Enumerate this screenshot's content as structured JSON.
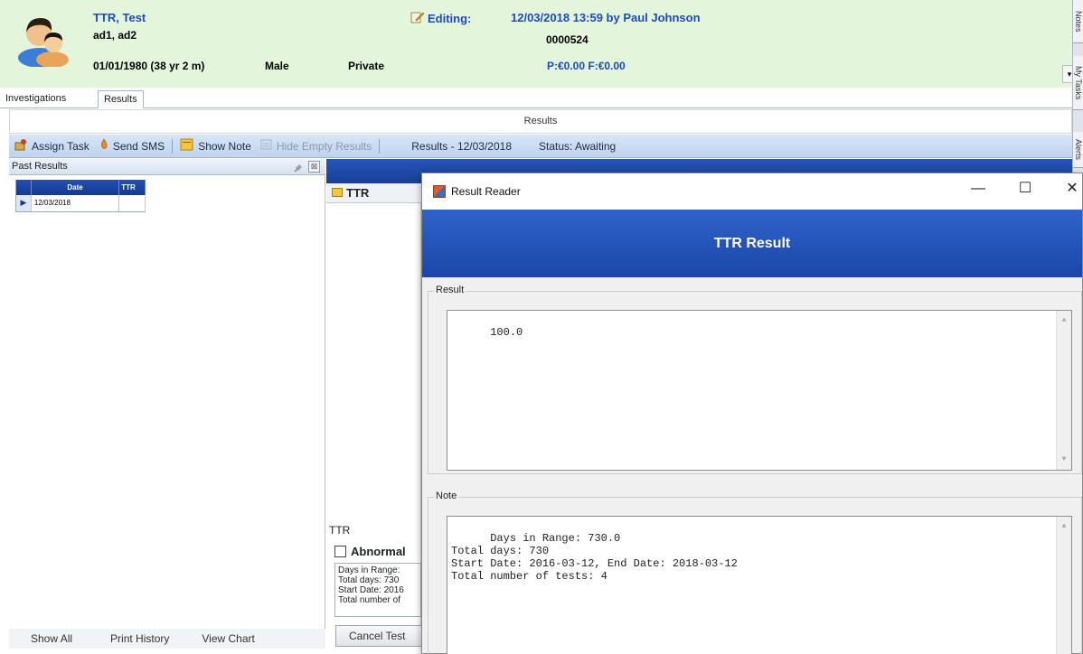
{
  "header": {
    "patient_name": "TTR, Test",
    "address": "ad1, ad2",
    "dob": "01/01/1980 (38 yr 2 m)",
    "gender": "Male",
    "insurance": "Private",
    "editing_label": "Editing:",
    "edit_info": "12/03/2018 13:59 by Paul Johnson",
    "patient_id": "0000524",
    "balance": "P:€0.00 F:€0.00",
    "dropdown_arrow": "▾"
  },
  "right_strip": {
    "tabs": [
      "Notes",
      "My Tasks",
      "Alerts"
    ]
  },
  "tabs": {
    "investigations": "Investigations",
    "results": "Results"
  },
  "results_title": "Results",
  "toolbar": {
    "assign_task": "Assign Task",
    "send_sms": "Send SMS",
    "show_note": "Show Note",
    "hide_empty": "Hide Empty Results",
    "results_date": "Results - 12/03/2018",
    "status": "Status: Awaiting"
  },
  "past_results": {
    "title": "Past Results",
    "close_glyph": "⊠",
    "columns": {
      "date": "Date",
      "ttr": "TTR"
    },
    "rows": [
      {
        "date": "12/03/2018",
        "ttr": ""
      }
    ],
    "selector_glyph": "▶",
    "footer": {
      "show_all": "Show All",
      "print_history": "Print History",
      "view_chart": "View Chart"
    }
  },
  "middle": {
    "ttr_row": "TTR",
    "ttr_label": "TTR",
    "abnormal": "Abnormal",
    "note_lines": [
      "Days in Range:",
      "Total days: 730",
      "Start Date: 2016",
      "Total number of"
    ],
    "cancel_test": "Cancel Test"
  },
  "dialog": {
    "title": "Result Reader",
    "min_glyph": "—",
    "max_glyph": "☐",
    "close_glyph": "✕",
    "banner": "TTR Result",
    "result_group": "Result",
    "result_value": "100.0",
    "note_group": "Note",
    "note_value": "Days in Range: 730.0\nTotal days: 730\nStart Date: 2016-03-12, End Date: 2018-03-12\nTotal number of tests: 4"
  },
  "colors": {
    "header_bg": "#e3f6dc",
    "header_blue_text": "#1b49c8",
    "toolbar_bg": "#c9daf2",
    "banner_blue": "#2454b8"
  },
  "icons": [
    "patient-avatar-icon",
    "edit-icon",
    "assign-task-icon",
    "sms-icon",
    "note-icon",
    "hide-empty-icon",
    "pin-icon",
    "folder-icon",
    "app-icon"
  ]
}
